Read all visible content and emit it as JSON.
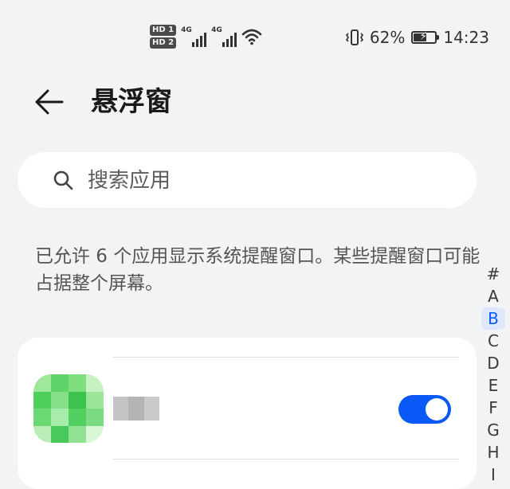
{
  "status_bar": {
    "sim1": "HD 1",
    "sim2": "HD 2",
    "net1": "4G",
    "net2": "4G",
    "battery_percent": "62%",
    "battery_level": 62,
    "time": "14:23",
    "icons": [
      "vibrate-icon",
      "wifi-icon",
      "signal-icon",
      "battery-charging-icon"
    ]
  },
  "header": {
    "title": "悬浮窗",
    "back_icon": "arrow-left-icon"
  },
  "search": {
    "placeholder": "搜索应用",
    "value": "",
    "icon": "search-icon"
  },
  "description": "已允许 6 个应用显示系统提醒窗口。某些提醒窗口可能占据整个屏幕。",
  "apps": [
    {
      "enabled": true
    }
  ],
  "index_bar": {
    "items": [
      "#",
      "A",
      "B",
      "C",
      "D",
      "E",
      "F",
      "G",
      "H",
      "I"
    ],
    "active": "B"
  },
  "colors": {
    "accent": "#0a59f7",
    "background": "#f1f3f5",
    "card": "#ffffff"
  }
}
